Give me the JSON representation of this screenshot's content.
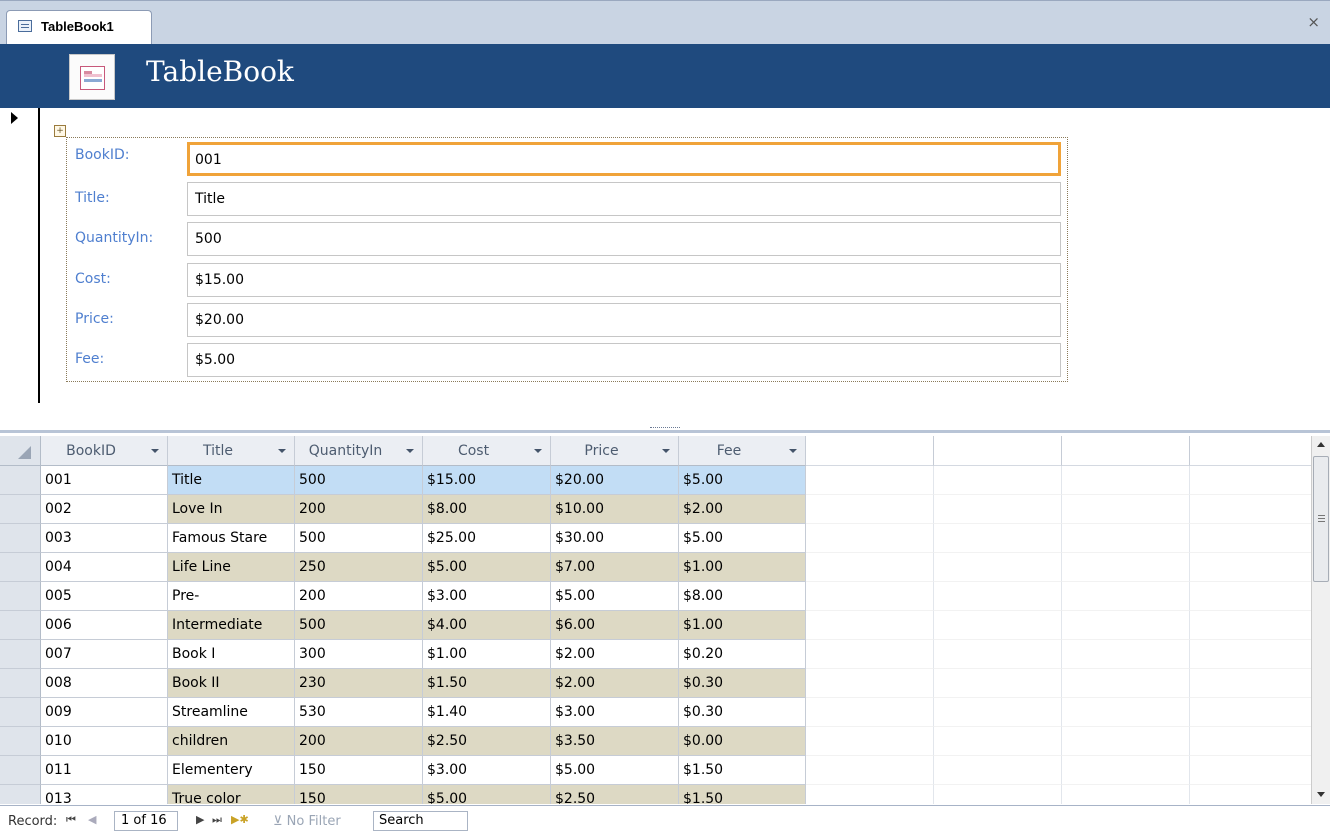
{
  "tab": {
    "label": "TableBook1",
    "close": "×"
  },
  "form": {
    "title": "TableBook"
  },
  "fields": [
    {
      "label": "BookID:",
      "value": "001"
    },
    {
      "label": "Title:",
      "value": "Title"
    },
    {
      "label": "QuantityIn:",
      "value": "500"
    },
    {
      "label": "Cost:",
      "value": "$15.00"
    },
    {
      "label": "Price:",
      "value": "$20.00"
    },
    {
      "label": "Fee:",
      "value": "$5.00"
    }
  ],
  "datasheet": {
    "columns": [
      "BookID",
      "Title",
      "QuantityIn",
      "Cost",
      "Price",
      "Fee"
    ],
    "rows": [
      [
        "001",
        "Title",
        "500",
        "$15.00",
        "$20.00",
        "$5.00"
      ],
      [
        "002",
        "Love In",
        "200",
        "$8.00",
        "$10.00",
        "$2.00"
      ],
      [
        "003",
        "Famous Stare",
        "500",
        "$25.00",
        "$30.00",
        "$5.00"
      ],
      [
        "004",
        "Life Line",
        "250",
        "$5.00",
        "$7.00",
        "$1.00"
      ],
      [
        "005",
        "Pre-",
        "200",
        "$3.00",
        "$5.00",
        "$8.00"
      ],
      [
        "006",
        "Intermediate",
        "500",
        "$4.00",
        "$6.00",
        "$1.00"
      ],
      [
        "007",
        "Book I",
        "300",
        "$1.00",
        "$2.00",
        "$0.20"
      ],
      [
        "008",
        "Book II",
        "230",
        "$1.50",
        "$2.00",
        "$0.30"
      ],
      [
        "009",
        "Streamline",
        "530",
        "$1.40",
        "$3.00",
        "$0.30"
      ],
      [
        "010",
        "children",
        "200",
        "$2.50",
        "$3.50",
        "$0.00"
      ],
      [
        "011",
        "Elementery",
        "150",
        "$3.00",
        "$5.00",
        "$1.50"
      ],
      [
        "013",
        "True color",
        "150",
        "$5.00",
        "$2.50",
        "$1.50"
      ]
    ]
  },
  "navigation": {
    "label": "Record:",
    "first": "⏮",
    "prev": "◀",
    "position": "1 of 16",
    "next": "▶",
    "last": "⏭",
    "new": "▶✱",
    "filter": "No Filter",
    "search": "Search"
  },
  "colors": {
    "header_blue": "#1f4a7e",
    "focus_orange": "#f0a339",
    "label_blue": "#4f7fcf",
    "alt_row": "#ddd9c4",
    "selected_row": "#c2ddf5"
  },
  "icons": [
    "form-icon",
    "close-icon",
    "record-selector-arrow-icon",
    "layout-move-icon",
    "dropdown-arrow-icon",
    "filter-icon"
  ]
}
